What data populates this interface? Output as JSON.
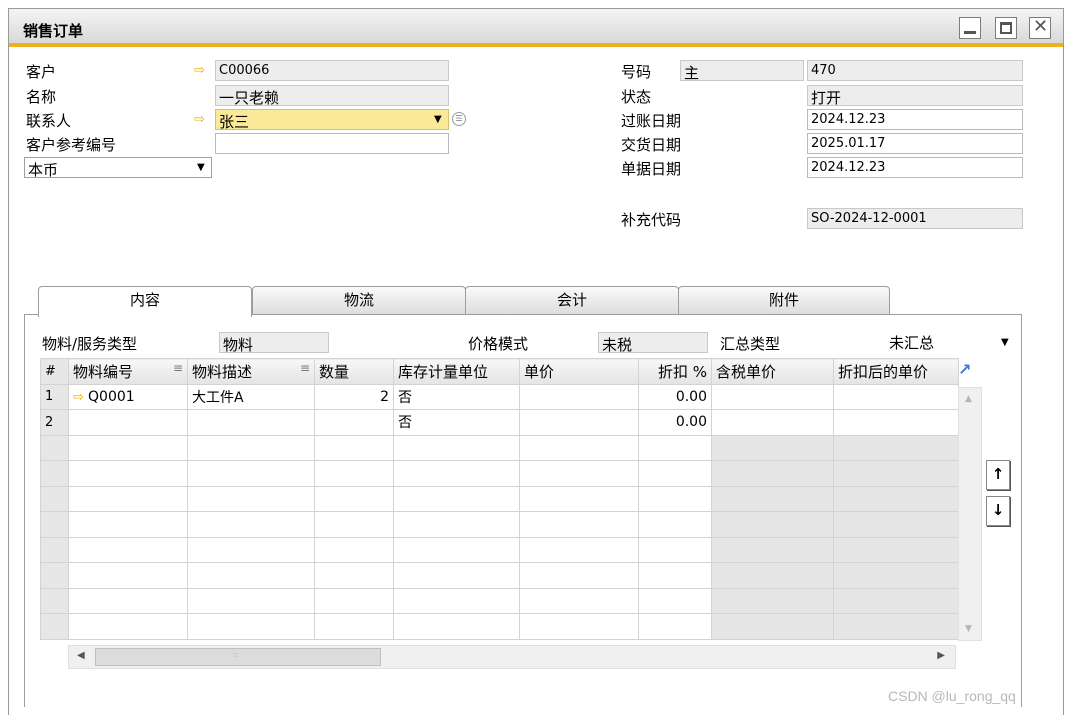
{
  "window": {
    "title": "销售订单"
  },
  "header_left": {
    "customer_label": "客户",
    "customer_value": "C00066",
    "name_label": "名称",
    "name_value": "一只老赖",
    "contact_label": "联系人",
    "contact_value": "张三",
    "ref_label": "客户参考编号",
    "ref_value": "",
    "currency_value": "本币"
  },
  "header_right": {
    "number_label": "号码",
    "series_value": "主",
    "number_value": "470",
    "status_label": "状态",
    "status_value": "打开",
    "posting_date_label": "过账日期",
    "posting_date_value": "2024.12.23",
    "delivery_date_label": "交货日期",
    "delivery_date_value": "2025.01.17",
    "doc_date_label": "单据日期",
    "doc_date_value": "2024.12.23",
    "extra_code_label": "补充代码",
    "extra_code_value": "SO-2024-12-0001"
  },
  "tabs": [
    "内容",
    "物流",
    "会计",
    "附件"
  ],
  "content": {
    "item_type_label": "物料/服务类型",
    "item_type_value": "物料",
    "price_mode_label": "价格模式",
    "price_mode_value": "未税",
    "summary_type_label": "汇总类型",
    "summary_type_value": "未汇总"
  },
  "grid": {
    "headers": [
      "#",
      "物料编号",
      "物料描述",
      "数量",
      "库存计量单位",
      "单价",
      "折扣 %",
      "含税单价",
      "折扣后的单价"
    ],
    "rows": [
      {
        "n": "1",
        "item": "Q0001",
        "desc": "大工件A",
        "qty": "2",
        "uom": "否",
        "price": "",
        "disc": "0.00",
        "gross": "",
        "after": ""
      },
      {
        "n": "2",
        "item": "",
        "desc": "",
        "qty": "",
        "uom": "否",
        "price": "",
        "disc": "0.00",
        "gross": "",
        "after": ""
      }
    ]
  },
  "watermark": "CSDN @lu_rong_qq"
}
